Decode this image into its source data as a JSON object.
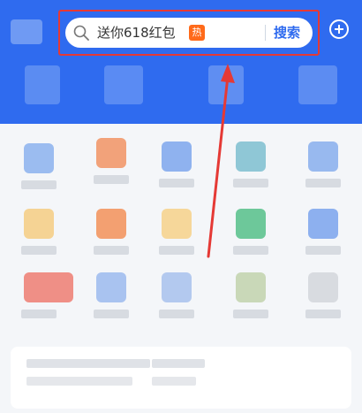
{
  "search": {
    "placeholder_text": "送你618红包",
    "hot_badge": "热",
    "button_label": "搜索",
    "search_icon": "search-icon"
  },
  "header": {
    "add_icon": "plus-circle-icon"
  },
  "colors": {
    "header_blue": "#2f6bef",
    "highlight_red": "#e53935",
    "hot_orange": "#ff6a1a",
    "background": "#f4f6f9"
  }
}
